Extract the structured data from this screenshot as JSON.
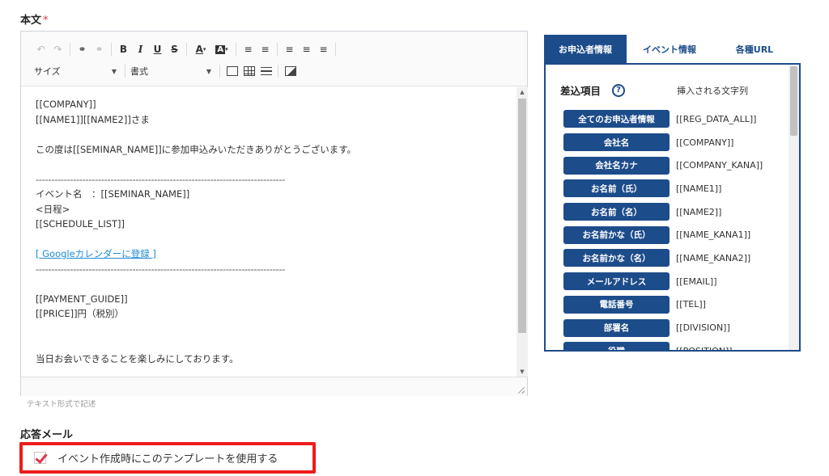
{
  "body_section": {
    "label": "本文",
    "required_mark": "*"
  },
  "toolbar": {
    "size_select": "サイズ",
    "format_select": "書式"
  },
  "editor": {
    "lines": [
      "[[COMPANY]]",
      "[[NAME1]][[NAME2]]さま",
      "",
      "この度は[[SEMINAR_NAME]]に参加申込みいただきありがとうございます。",
      "",
      "--------------------------------------------------------------------------------",
      "イベント名　：[[SEMINAR_NAME]]",
      "<日程>",
      " [[SCHEDULE_LIST]]",
      "",
      "[ Googleカレンダーに登録 ]",
      "--------------------------------------------------------------------------------",
      "",
      "[[PAYMENT_GUIDE]]",
      "[[PRICE]]円（税別）",
      "",
      "",
      "当日お会いできることを楽しみにしております。"
    ],
    "hint": "テキスト形式で記述"
  },
  "tabs": [
    {
      "label": "お申込者情報"
    },
    {
      "label": "イベント情報"
    },
    {
      "label": "各種URL"
    }
  ],
  "panel": {
    "title": "差込項目",
    "help": "?",
    "column2": "挿入される文字列",
    "items": [
      {
        "label": "全てのお申込者情報",
        "tag": "[[REG_DATA_ALL]]"
      },
      {
        "label": "会社名",
        "tag": "[[COMPANY]]"
      },
      {
        "label": "会社名カナ",
        "tag": "[[COMPANY_KANA]]"
      },
      {
        "label": "お名前（氏）",
        "tag": "[[NAME1]]"
      },
      {
        "label": "お名前（名）",
        "tag": "[[NAME2]]"
      },
      {
        "label": "お名前かな（氏）",
        "tag": "[[NAME_KANA1]]"
      },
      {
        "label": "お名前かな（名）",
        "tag": "[[NAME_KANA2]]"
      },
      {
        "label": "メールアドレス",
        "tag": "[[EMAIL]]"
      },
      {
        "label": "電話番号",
        "tag": "[[TEL]]"
      },
      {
        "label": "部署名",
        "tag": "[[DIVISION]]"
      },
      {
        "label": "役職",
        "tag": "[[POSITION]]"
      }
    ]
  },
  "reply_section": {
    "label": "応答メール",
    "checkbox_label": "イベント作成時にこのテンプレートを使用する",
    "checked": true
  },
  "colors": {
    "accent": "#1d4c8a",
    "required": "#e0334d",
    "highlight": "#ee1c1c",
    "link": "#1e8bd8"
  }
}
